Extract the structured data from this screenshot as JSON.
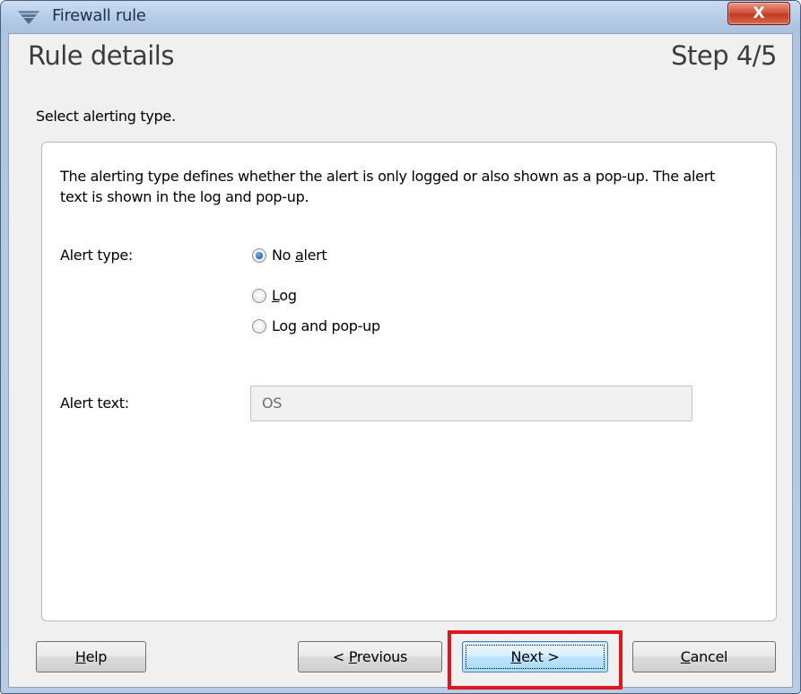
{
  "window": {
    "title": "Firewall rule",
    "close_glyph": "X"
  },
  "header": {
    "heading": "Rule details",
    "step": "Step 4/5",
    "subheading": "Select alerting type."
  },
  "panel": {
    "description": "The alerting type defines whether the alert is only logged or also shown as a pop-up. The alert text is shown in the log and pop-up.",
    "alert_type_label": "Alert type:",
    "alert_options": [
      {
        "pre": "No ",
        "key": "a",
        "post": "lert",
        "selected": true
      },
      {
        "pre": "",
        "key": "L",
        "post": "og",
        "selected": false
      },
      {
        "pre": "Lo",
        "key": "g",
        "post": " and pop-up",
        "selected": false
      }
    ],
    "alert_text_label": "Alert text:",
    "alert_text_value": "OS"
  },
  "buttons": {
    "help": {
      "pre": "",
      "key": "H",
      "post": "elp"
    },
    "previous": {
      "pre": "< ",
      "key": "P",
      "post": "revious"
    },
    "next": {
      "pre": "",
      "key": "N",
      "post": "ext >"
    },
    "cancel": {
      "pre": "",
      "key": "C",
      "post": "ancel"
    }
  },
  "colors": {
    "highlight": "#e0161f",
    "selected_radio": "#1f67b8"
  },
  "icons": {
    "app": "firewall-shield-icon",
    "close": "close-icon"
  }
}
